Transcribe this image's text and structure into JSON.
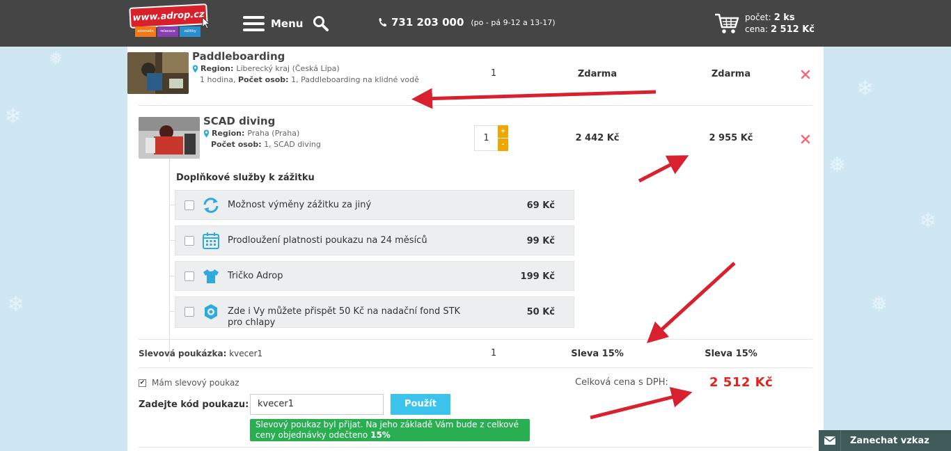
{
  "header": {
    "logo_text": "www.adrop.cz",
    "logo_tags": [
      "adrenalin",
      "relaxace",
      "zážitky"
    ],
    "menu_label": "Menu",
    "phone_number": "731 203 000",
    "phone_hours": "(po - pá 9-12 a 13-17)",
    "cart_count_label": "počet:",
    "cart_count_value": "2 ks",
    "cart_price_label": "cena:",
    "cart_price_value": "2 512 Kč"
  },
  "cart": {
    "items": [
      {
        "title": "Paddleboarding",
        "region_label": "Region:",
        "region_value": "Liberecký kraj (Česká Lípa)",
        "detail_pre": "1 hodina, ",
        "detail_bold": "Počet osob:",
        "detail_post": " 1, Paddleboarding na klidné vodě",
        "qty": "1",
        "price": "Zdarma",
        "total": "Zdarma"
      },
      {
        "title": "SCAD diving",
        "region_label": "Region:",
        "region_value": "Praha (Praha)",
        "detail_pre": "",
        "detail_bold": "Počet osob:",
        "detail_post": " 1, SCAD diving",
        "qty": "1",
        "price": "2 442 Kč",
        "total": "2 955 Kč"
      }
    ],
    "qty_plus": "+",
    "qty_minus": "-"
  },
  "addons": {
    "title": "Doplňkové služby k zážitku",
    "items": [
      {
        "label": "Možnost výměny zážitku za jiný",
        "price": "69 Kč",
        "icon": "exchange-icon"
      },
      {
        "label": "Prodloužení platnosti poukazu na 24 měsíců",
        "price": "99 Kč",
        "icon": "calendar-icon"
      },
      {
        "label": "Tričko Adrop",
        "price": "199 Kč",
        "icon": "tshirt-icon"
      },
      {
        "label": "Zde i Vy můžete přispět 50 Kč na nadační fond STK pro chlapy",
        "price": "50 Kč",
        "icon": "donation-icon"
      }
    ]
  },
  "voucher_row": {
    "label_bold": "Slevová poukázka:",
    "label_value": " kvecer1",
    "qty": "1",
    "price": "Sleva 15%",
    "total": "Sleva 15%"
  },
  "voucher_form": {
    "have_voucher_label": "Mám slevový poukaz",
    "checked_mark": "✔",
    "code_label": "Zadejte kód poukazu:",
    "code_value": "kvecer1",
    "apply_label": "Použít",
    "success_pre": "Slevový poukaz byl přijat. Na jeho základě Vám bude z celkové ceny objednávky odečteno ",
    "success_bold": "15%"
  },
  "summary": {
    "total_label": "Celková cena s DPH:",
    "total_value": "2 512 Kč"
  },
  "chat": {
    "label": "Zanechat vzkaz"
  },
  "colors": {
    "header_bg": "#454545",
    "accent_red": "#e0231d",
    "apply_blue": "#3cc3ec",
    "success_green": "#2aae52",
    "qty_orange": "#f0a500",
    "remove_pink": "#f06a7a",
    "icon_blue": "#2fa9de",
    "arrow_red": "#d9202e"
  }
}
